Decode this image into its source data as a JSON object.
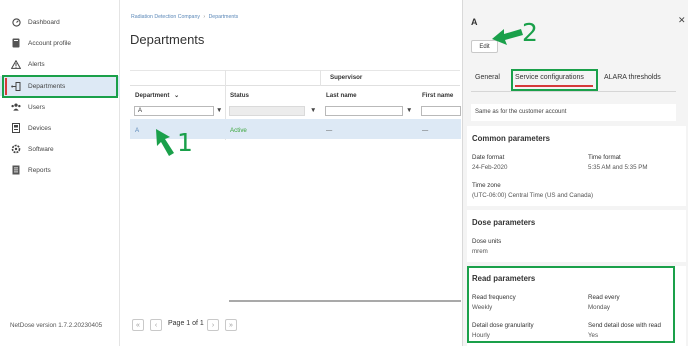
{
  "sidebar": {
    "items": [
      {
        "label": "Dashboard",
        "icon": "dashboard-icon"
      },
      {
        "label": "Account profile",
        "icon": "account-profile-icon"
      },
      {
        "label": "Alerts",
        "icon": "alert-icon"
      },
      {
        "label": "Departments",
        "icon": "departments-icon",
        "active": true
      },
      {
        "label": "Users",
        "icon": "users-icon"
      },
      {
        "label": "Devices",
        "icon": "devices-icon"
      },
      {
        "label": "Software",
        "icon": "software-icon"
      },
      {
        "label": "Reports",
        "icon": "reports-icon"
      }
    ],
    "version": "NetDose version 1.7.2.20230405"
  },
  "main": {
    "breadcrumb": {
      "parent": "Radiation Detection Company",
      "separator": "›",
      "current": "Departments"
    },
    "title": "Departments",
    "table": {
      "group_header": "Supervisor",
      "columns": [
        "Department",
        "Status",
        "Last name",
        "First name"
      ],
      "sort_indicator": "⌄",
      "filters": {
        "department": "A"
      },
      "rows": [
        {
          "department": "A",
          "status": "Active",
          "last_name": "—",
          "first_name": "—"
        }
      ]
    },
    "pager": {
      "label": "Page 1 of 1"
    }
  },
  "annotations": {
    "one": "1",
    "two": "2"
  },
  "panel": {
    "title": "A",
    "edit_label": "Edit",
    "tabs": [
      "General",
      "Service configurations",
      "ALARA thresholds"
    ],
    "active_tab": "Service configurations",
    "info": "Same as for the customer account",
    "common": {
      "title": "Common parameters",
      "date_format_label": "Date format",
      "date_format_value": "24-Feb-2020",
      "time_format_label": "Time format",
      "time_format_value": "5:35 AM and 5:35 PM",
      "time_zone_label": "Time zone",
      "time_zone_value": "(UTC-06:00) Central Time (US and Canada)"
    },
    "dose": {
      "title": "Dose parameters",
      "units_label": "Dose units",
      "units_value": "mrem"
    },
    "read": {
      "title": "Read parameters",
      "frequency_label": "Read frequency",
      "frequency_value": "Weekly",
      "every_label": "Read every",
      "every_value": "Monday",
      "granularity_label": "Detail dose granularity",
      "granularity_value": "Hourly",
      "send_label": "Send detail dose with read",
      "send_value": "Yes"
    }
  },
  "colors": {
    "accent_green": "#1aa04a",
    "active_red": "#d63a3a",
    "selected_row": "#dde9f5",
    "status_active": "#3aa53a",
    "link_blue": "#5b88b8"
  }
}
